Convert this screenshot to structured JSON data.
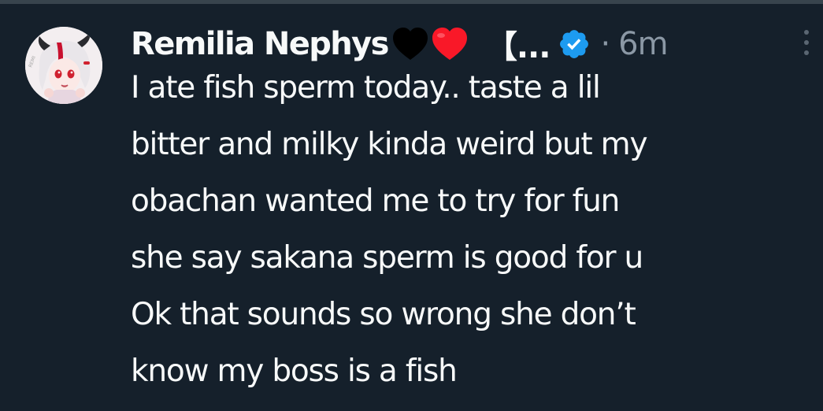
{
  "tweet": {
    "author": {
      "display_name": "Remilia Nephys",
      "name_emoji": [
        "black-heart-icon",
        "red-heart-icon"
      ],
      "name_suffix": "【...",
      "verified": true
    },
    "separator": "·",
    "timestamp": "6m",
    "text_lines": [
      "I ate fish sperm today.. taste a lil",
      "bitter and milky kinda weird but my",
      "obachan wanted me to try for fun",
      "she say sakana sperm is good for u",
      "Ok that sounds so wrong she don’t",
      "know my boss is a fish"
    ]
  },
  "icons": {
    "more": "more-options-icon",
    "verified": "verified-badge-icon"
  },
  "colors": {
    "background": "#15202b",
    "text": "#f7f9f9",
    "secondary_text": "#8b98a5",
    "verified_blue": "#1d9bf0",
    "heart_red": "#f91828",
    "heart_black": "#000000"
  }
}
